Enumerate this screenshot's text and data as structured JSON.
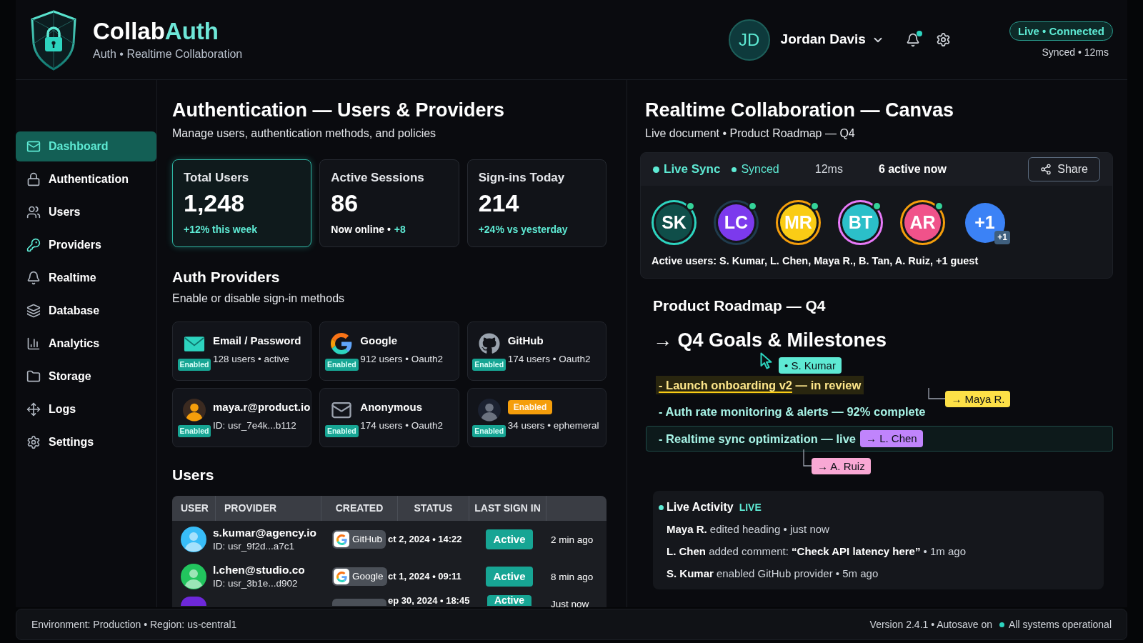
{
  "header": {
    "brand": "Collab",
    "brand_accent": "Auth",
    "tagline": "Auth • Realtime Collaboration",
    "user": {
      "initials": "JD",
      "name": "Jordan Davis"
    },
    "unread_notifications": true,
    "connection": "Live • Connected",
    "sync": "Synced • 12ms"
  },
  "sidebar": {
    "items": [
      {
        "label": "Dashboard",
        "selected": true
      },
      {
        "label": "Authentication",
        "selected": false
      },
      {
        "label": "Users",
        "selected": false
      },
      {
        "label": "Providers",
        "selected": false
      },
      {
        "label": "Realtime",
        "selected": false
      },
      {
        "label": "Database",
        "selected": false
      },
      {
        "label": "Analytics",
        "selected": false
      },
      {
        "label": "Storage",
        "selected": false
      },
      {
        "label": "Logs",
        "selected": false
      },
      {
        "label": "Settings",
        "selected": false
      }
    ]
  },
  "auth": {
    "title": "Authentication — Users & Providers",
    "subtitle": "Manage users, authentication methods, and policies",
    "stats": [
      {
        "label": "Total Users",
        "value": "1,248",
        "delta": "+12% this week",
        "selected": true
      },
      {
        "label": "Active Sessions",
        "value": "86",
        "note": "Now online •",
        "delta": "+8",
        "selected": false
      },
      {
        "label": "Sign-ins Today",
        "value": "214",
        "delta": "+24% vs yesterday",
        "selected": false
      }
    ],
    "providers_title": "Auth Providers",
    "providers_subtitle": "Enable or disable sign-in methods",
    "providers": [
      {
        "name": "Email / Password",
        "detail": "128 users • active",
        "badge": "Enabled",
        "enabled": true
      },
      {
        "name": "Google",
        "detail": "912 users • Oauth2",
        "badge": "Enabled",
        "enabled": true
      },
      {
        "name": "GitHub",
        "detail": "174 users • Oauth2",
        "badge": "Enabled",
        "enabled": true
      },
      {
        "name": "maya.r@product.io",
        "detail": "ID: usr_7e4k...b112",
        "badge": "Enabled",
        "enabled": true
      },
      {
        "name": "Anonymous",
        "detail": "174 users • Oauth2",
        "badge": "Enabled",
        "enabled": true
      },
      {
        "title_badge": "Enabled",
        "detail": "34 users • ephemeral",
        "badge": "Enabled",
        "enabled": true
      }
    ],
    "users_title": "Users",
    "table": {
      "columns": [
        "USER",
        "PROVIDER",
        "CREATED",
        "STATUS",
        "LAST SIGN IN"
      ],
      "rows": [
        {
          "kind": "full",
          "color": "#38bdf8",
          "email": "s.kumar@agency.io",
          "id": "ID: usr_9f2d...a7c1",
          "provider": "GitHub",
          "created": "ct 2, 2024 • 14:22",
          "status": "Active",
          "last_sign_in": "2 min ago"
        },
        {
          "kind": "full",
          "color": "#22c55e",
          "email": "l.chen@studio.co",
          "id": "ID: usr_3b1e...d902",
          "provider": "Google",
          "created": "ct 1, 2024 • 09:11",
          "status": "Active",
          "last_sign_in": "8 min ago"
        },
        {
          "kind": "partial",
          "color": "#6d28d9",
          "created": "ep 30, 2024 • 18:45",
          "status": "Active",
          "last_sign_in": "Just now"
        }
      ]
    }
  },
  "collab": {
    "title": "Realtime Collaboration — Canvas",
    "subtitle": "Live document • Product Roadmap — Q4",
    "sync": {
      "live": "Live Sync",
      "synced": "Synced",
      "latency": "12ms",
      "active": "6 active now"
    },
    "share": "Share",
    "avatars": [
      {
        "initials": "SK",
        "color": "#0f4e49",
        "online": true
      },
      {
        "initials": "LC",
        "color": "#7c3aed",
        "online": true
      },
      {
        "initials": "MR",
        "color": "#facc15",
        "online": true
      },
      {
        "initials": "BT",
        "color": "#2bbfc9",
        "online": true
      },
      {
        "initials": "AR",
        "color": "#f0528a",
        "online": true
      },
      {
        "initials": "+1",
        "color": "#3b82f6",
        "online": false,
        "badge": "+1"
      }
    ],
    "active_users": "Active users: S. Kumar, L. Chen, Maya R., B. Tan, A. Ruiz, +1 guest",
    "doc": {
      "title": "Product Roadmap — Q4",
      "heading": "→ Q4 Goals & Milestones",
      "heading_cursor": {
        "label": "• S. Kumar",
        "color": "#5eead4"
      },
      "lines": [
        {
          "kind": "highlight",
          "text": "- Launch onboarding v2",
          "suffix": "— in review"
        },
        {
          "kind": "plain",
          "text": "- Auth rate monitoring & alerts — 92% complete",
          "cursors": [
            {
              "kind": "leader_above",
              "label": "→ Maya R.",
              "color": "#fde047"
            }
          ]
        },
        {
          "kind": "boxed",
          "text": "- Realtime sync optimization — live",
          "cursors": [
            {
              "kind": "inline",
              "label": "→ L. Chen",
              "color": "#c084fc"
            },
            {
              "kind": "leader_below",
              "label": "→ A. Ruiz",
              "color": "#f9a8d4"
            }
          ]
        }
      ]
    },
    "activity": {
      "title": "Live Activity",
      "badge": "LIVE",
      "items": [
        "**Maya R.** edited heading • just now",
        "**L. Chen** added comment: **“Check API latency here”** • 1m ago",
        "**S. Kumar** enabled GitHub provider • 5m ago"
      ]
    }
  },
  "footer": {
    "environment": "Environment: Production • Region: us-central1",
    "version": "Version 2.4.1 • Autosave on",
    "status": "All systems operational",
    "operational": true
  }
}
